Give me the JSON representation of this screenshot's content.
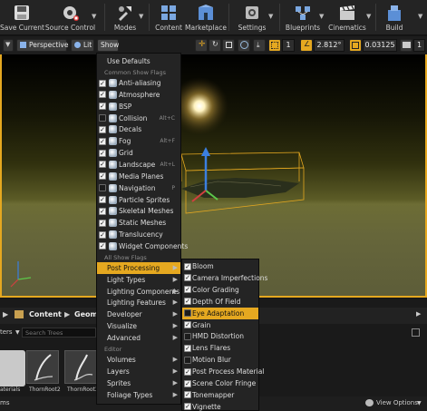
{
  "toolbar": {
    "save_current": "Save Current",
    "source_control": "Source Control",
    "modes": "Modes",
    "content": "Content",
    "marketplace": "Marketplace",
    "settings": "Settings",
    "blueprints": "Blueprints",
    "cinematics": "Cinematics",
    "build": "Build"
  },
  "viewport_bar": {
    "perspective": "Perspective",
    "lit": "Lit",
    "show": "Show",
    "grid_snap": "1",
    "rotation_snap": "2.812°",
    "scale_snap": "0.03125",
    "camera_speed": "1"
  },
  "show_menu": {
    "use_defaults": "Use Defaults",
    "common_header": "Common Show Flags",
    "common": [
      {
        "label": "Anti-aliasing",
        "checked": true,
        "icon": "anti-aliasing-icon"
      },
      {
        "label": "Atmosphere",
        "checked": true,
        "icon": "atmosphere-icon"
      },
      {
        "label": "BSP",
        "checked": true,
        "icon": "bsp-icon"
      },
      {
        "label": "Collision",
        "checked": false,
        "icon": "collision-icon",
        "hotkey": "Alt+C"
      },
      {
        "label": "Decals",
        "checked": true,
        "icon": "decals-icon"
      },
      {
        "label": "Fog",
        "checked": true,
        "icon": "fog-icon",
        "hotkey": "Alt+F"
      },
      {
        "label": "Grid",
        "checked": true,
        "icon": "grid-icon"
      },
      {
        "label": "Landscape",
        "checked": true,
        "icon": "landscape-icon",
        "hotkey": "Alt+L"
      },
      {
        "label": "Media Planes",
        "checked": true,
        "icon": "media-planes-icon"
      },
      {
        "label": "Navigation",
        "checked": false,
        "icon": "navigation-icon",
        "hotkey": "P"
      },
      {
        "label": "Particle Sprites",
        "checked": true,
        "icon": "particle-sprites-icon"
      },
      {
        "label": "Skeletal Meshes",
        "checked": true,
        "icon": "skeletal-meshes-icon"
      },
      {
        "label": "Static Meshes",
        "checked": true,
        "icon": "static-meshes-icon"
      },
      {
        "label": "Translucency",
        "checked": true,
        "icon": "translucency-icon"
      },
      {
        "label": "Widget Components",
        "checked": true,
        "icon": "widget-components-icon"
      }
    ],
    "all_header": "All Show Flags",
    "all": [
      "Post Processing",
      "Light Types",
      "Lighting Components",
      "Lighting Features",
      "Developer",
      "Visualize",
      "Advanced"
    ],
    "editor_header": "Editor",
    "editor": [
      "Volumes",
      "Layers",
      "Sprites",
      "Foliage Types"
    ]
  },
  "post_processing_menu": {
    "items": [
      {
        "label": "Bloom",
        "checked": true
      },
      {
        "label": "Camera Imperfections",
        "checked": true
      },
      {
        "label": "Color Grading",
        "checked": true
      },
      {
        "label": "Depth Of Field",
        "checked": true
      },
      {
        "label": "Eye Adaptation",
        "checked": false
      },
      {
        "label": "Grain",
        "checked": true
      },
      {
        "label": "HMD Distortion",
        "checked": false
      },
      {
        "label": "Lens Flares",
        "checked": true
      },
      {
        "label": "Motion Blur",
        "checked": false
      },
      {
        "label": "Post Process Material",
        "checked": true
      },
      {
        "label": "Scene Color Fringe",
        "checked": true
      },
      {
        "label": "Tonemapper",
        "checked": true
      },
      {
        "label": "Vignette",
        "checked": true
      }
    ]
  },
  "content_browser": {
    "crumb_content": "Content",
    "crumb_geom": "Geome",
    "filters": "ters",
    "search_placeholder": "Search Trees",
    "assets": [
      "aterials",
      "ThornRoot2",
      "ThornRoot3"
    ],
    "items_label": "ms",
    "view_options": "View Options"
  },
  "colors": {
    "accent": "#e5a820",
    "menu_bg": "#242424",
    "toolbar_bg": "#242424"
  }
}
